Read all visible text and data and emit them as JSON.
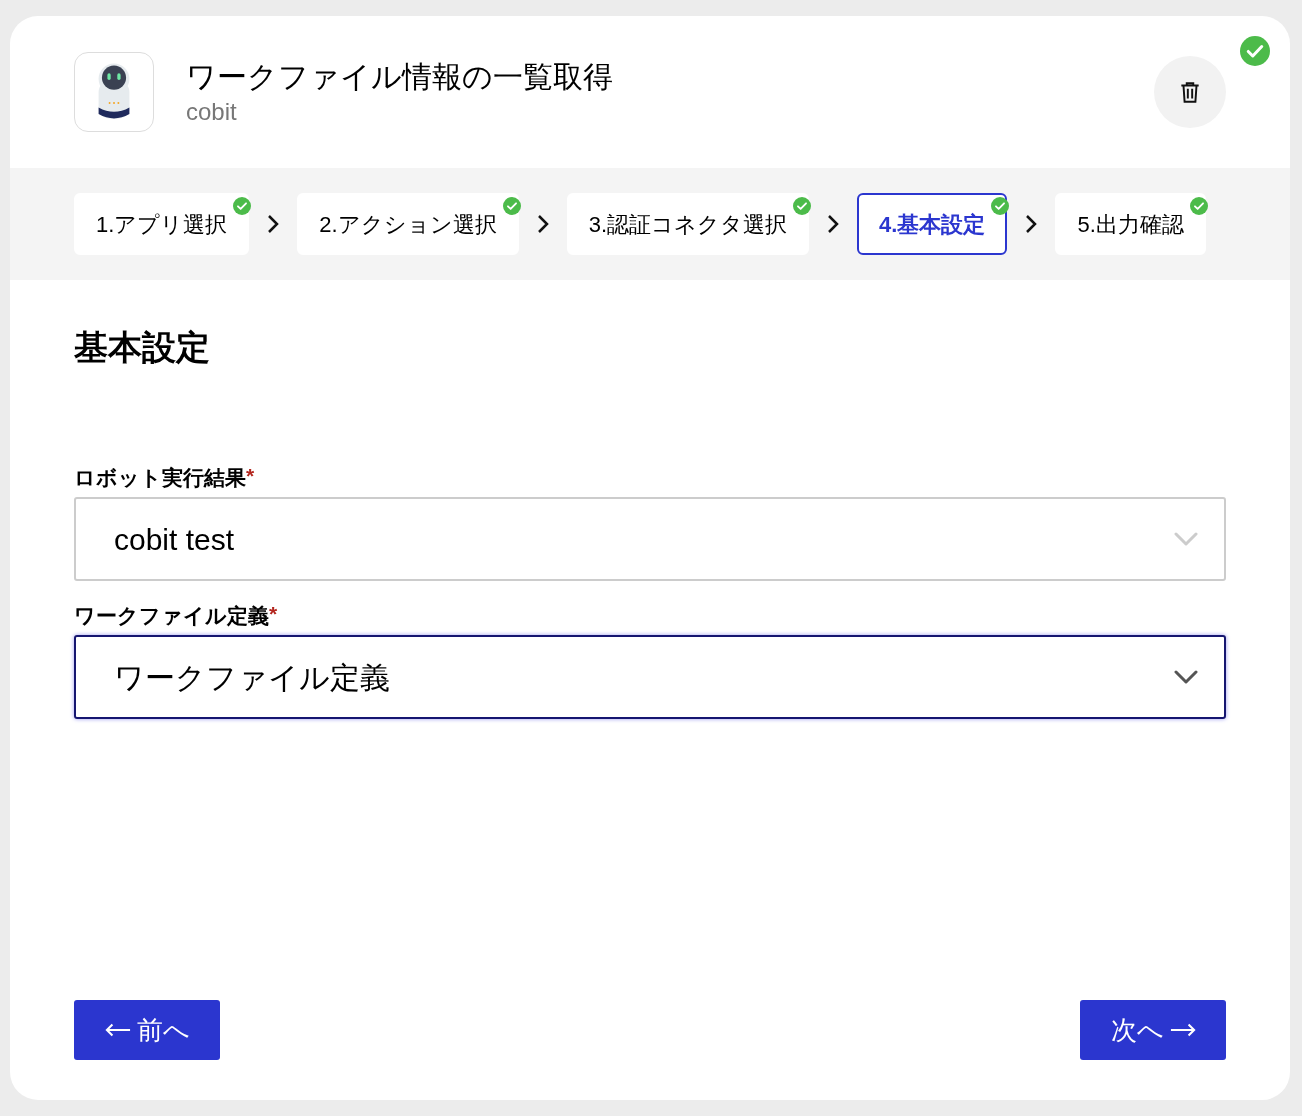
{
  "header": {
    "title": "ワークファイル情報の一覧取得",
    "subtitle": "cobit",
    "complete": true
  },
  "steps": [
    {
      "label": "1.アプリ選択",
      "done": true,
      "selected": false
    },
    {
      "label": "2.アクション選択",
      "done": true,
      "selected": false
    },
    {
      "label": "3.認証コネクタ選択",
      "done": true,
      "selected": false
    },
    {
      "label": "4.基本設定",
      "done": true,
      "selected": true
    },
    {
      "label": "5.出力確認",
      "done": true,
      "selected": false
    }
  ],
  "section_title": "基本設定",
  "fields": [
    {
      "label": "ロボット実行結果",
      "required_mark": "*",
      "value": "cobit test",
      "focused": false
    },
    {
      "label": "ワークファイル定義",
      "required_mark": "*",
      "value": "ワークファイル定義",
      "focused": true
    }
  ],
  "buttons": {
    "back": "前へ",
    "next": "次へ"
  }
}
